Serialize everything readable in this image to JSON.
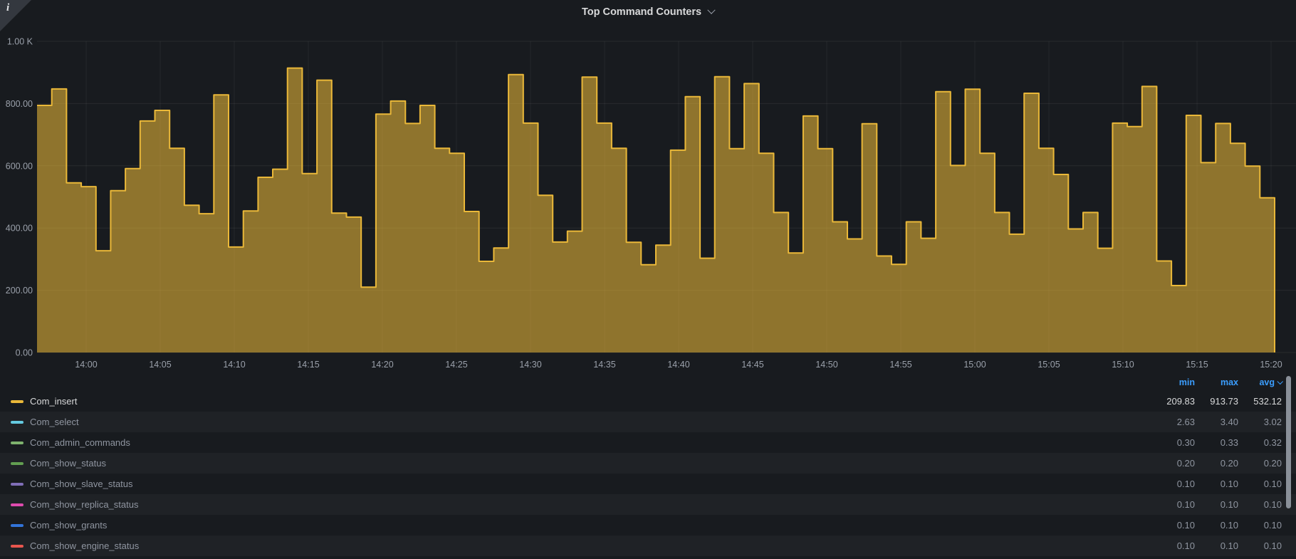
{
  "panel": {
    "title": "Top Command Counters",
    "info_icon": "i"
  },
  "colors": {
    "background": "#181b1f",
    "grid": "rgba(255,255,255,0.07)",
    "axis_text": "#9aa0aa",
    "legend_header_blue": "#3b9eff",
    "legend_text": "#8f95a0",
    "legend_text_active": "#d8d9da",
    "main_series_line": "#EAB839"
  },
  "chart_data": {
    "type": "area",
    "title": "Top Command Counters",
    "style": "stepped-area",
    "grid": true,
    "legend_position": "bottom-table",
    "legend_columns": [
      "min",
      "max",
      "avg"
    ],
    "sorted_by": "avg",
    "ylim": [
      0,
      1000
    ],
    "y_ticks": [
      "1.00 K",
      "800.00",
      "600.00",
      "400.00",
      "200.00",
      "0.00"
    ],
    "y_tick_values": [
      1000,
      800,
      600,
      400,
      200,
      0
    ],
    "x_ticks": [
      "14:00",
      "14:05",
      "14:10",
      "14:15",
      "14:20",
      "14:25",
      "14:30",
      "14:35",
      "14:40",
      "14:45",
      "14:50",
      "14:55",
      "15:00",
      "15:05",
      "15:10",
      "15:15",
      "15:20"
    ],
    "x_start": "13:56",
    "x_step_minutes": 1,
    "series": [
      {
        "name": "Com_insert",
        "color": "#EAB839",
        "active": true,
        "min": "209.83",
        "max": "913.73",
        "avg": "532.12",
        "values": [
          794,
          847,
          545,
          533,
          327,
          520,
          591,
          744,
          778,
          656,
          473,
          446,
          828,
          339,
          455,
          563,
          589,
          914,
          575,
          875,
          448,
          435,
          210,
          766,
          808,
          736,
          794,
          656,
          640,
          453,
          293,
          336,
          893,
          737,
          505,
          355,
          390,
          885,
          737,
          656,
          354,
          282,
          345,
          650,
          822,
          303,
          886,
          655,
          864,
          640,
          450,
          320,
          760,
          655,
          420,
          365,
          735,
          310,
          283,
          420,
          367,
          838,
          601,
          846,
          640,
          450,
          380,
          833,
          656,
          572,
          397,
          450,
          335,
          737,
          726,
          855,
          294,
          215,
          762,
          610,
          736,
          672,
          599,
          497
        ]
      },
      {
        "name": "Com_select",
        "color": "#64C9E0",
        "active": false,
        "min": "2.63",
        "max": "3.40",
        "avg": "3.02"
      },
      {
        "name": "Com_admin_commands",
        "color": "#7EB26D",
        "active": false,
        "min": "0.30",
        "max": "0.33",
        "avg": "0.32"
      },
      {
        "name": "Com_show_status",
        "color": "#629E51",
        "active": false,
        "min": "0.20",
        "max": "0.20",
        "avg": "0.20"
      },
      {
        "name": "Com_show_slave_status",
        "color": "#806EB7",
        "active": false,
        "min": "0.10",
        "max": "0.10",
        "avg": "0.10"
      },
      {
        "name": "Com_show_replica_status",
        "color": "#DE4BAE",
        "active": false,
        "min": "0.10",
        "max": "0.10",
        "avg": "0.10"
      },
      {
        "name": "Com_show_grants",
        "color": "#3274D9",
        "active": false,
        "min": "0.10",
        "max": "0.10",
        "avg": "0.10"
      },
      {
        "name": "Com_show_engine_status",
        "color": "#E8564E",
        "active": false,
        "min": "0.10",
        "max": "0.10",
        "avg": "0.10"
      }
    ]
  }
}
